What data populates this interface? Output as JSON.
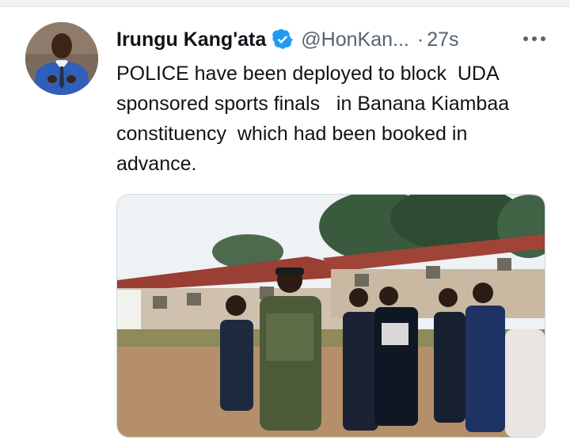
{
  "tweet": {
    "author_name": "Irungu Kang'ata",
    "handle": "@HonKan...",
    "separator": "·",
    "timestamp": "27s",
    "text": "POLICE have been deployed to block  UDA sponsored sports finals   in Banana Kiambaa constituency  which had been booked in advance.",
    "verified_icon": "verified-badge-icon",
    "more_icon": "more-options-icon",
    "accent_color": "#1d9bf0"
  }
}
